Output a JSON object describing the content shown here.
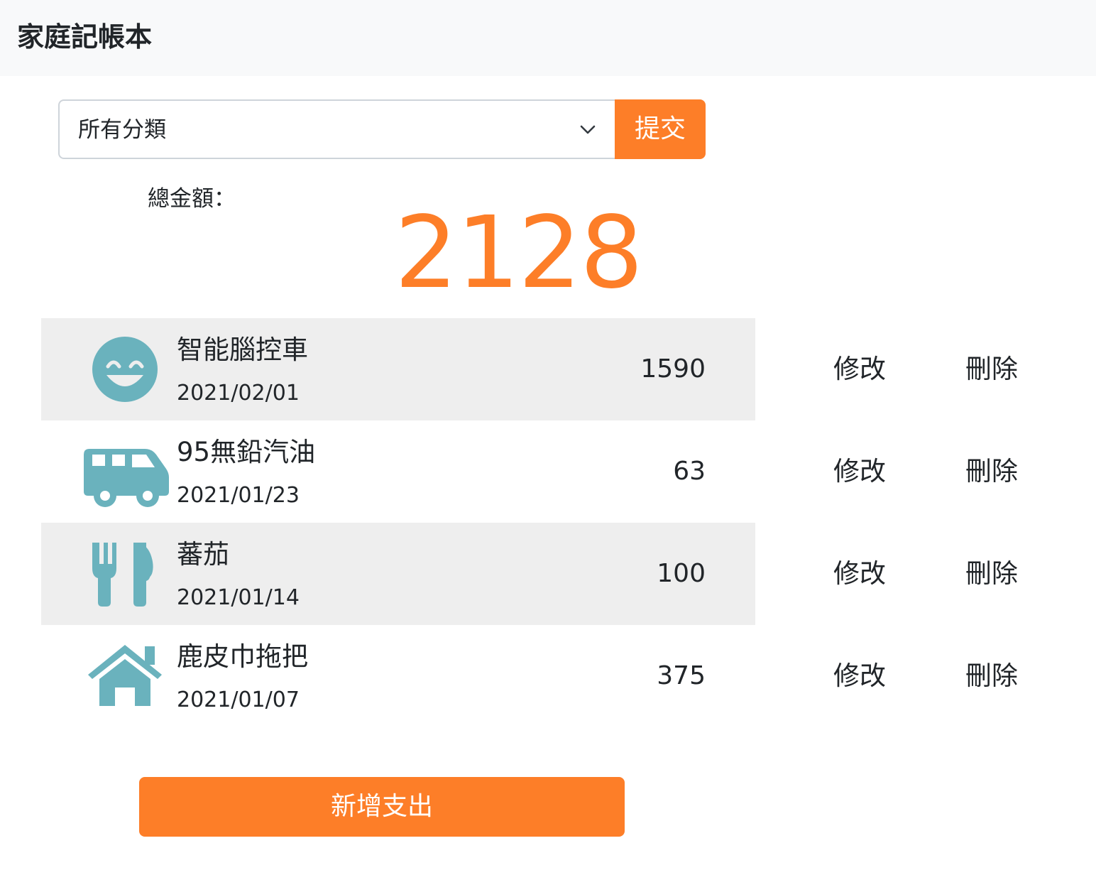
{
  "navbar": {
    "brand": "家庭記帳本"
  },
  "filter": {
    "selected": "所有分類",
    "submit_label": "提交"
  },
  "summary": {
    "label": "總金額：",
    "total": "2128"
  },
  "records": [
    {
      "icon": "smile-beam-icon",
      "name": "智能腦控車",
      "date": "2021/02/01",
      "amount": "1590",
      "edit_label": "修改",
      "delete_label": "刪除"
    },
    {
      "icon": "shuttle-van-icon",
      "name": "95無鉛汽油",
      "date": "2021/01/23",
      "amount": "63",
      "edit_label": "修改",
      "delete_label": "刪除"
    },
    {
      "icon": "utensils-icon",
      "name": "蕃茄",
      "date": "2021/01/14",
      "amount": "100",
      "edit_label": "修改",
      "delete_label": "刪除"
    },
    {
      "icon": "home-icon",
      "name": "鹿皮巾拖把",
      "date": "2021/01/07",
      "amount": "375",
      "edit_label": "修改",
      "delete_label": "刪除"
    }
  ],
  "actions": {
    "add_label": "新增支出"
  },
  "colors": {
    "accent": "#fd7e28",
    "icon": "#6ab2bd",
    "stripe": "#eeeeee",
    "navbar": "#f8f9fa"
  }
}
